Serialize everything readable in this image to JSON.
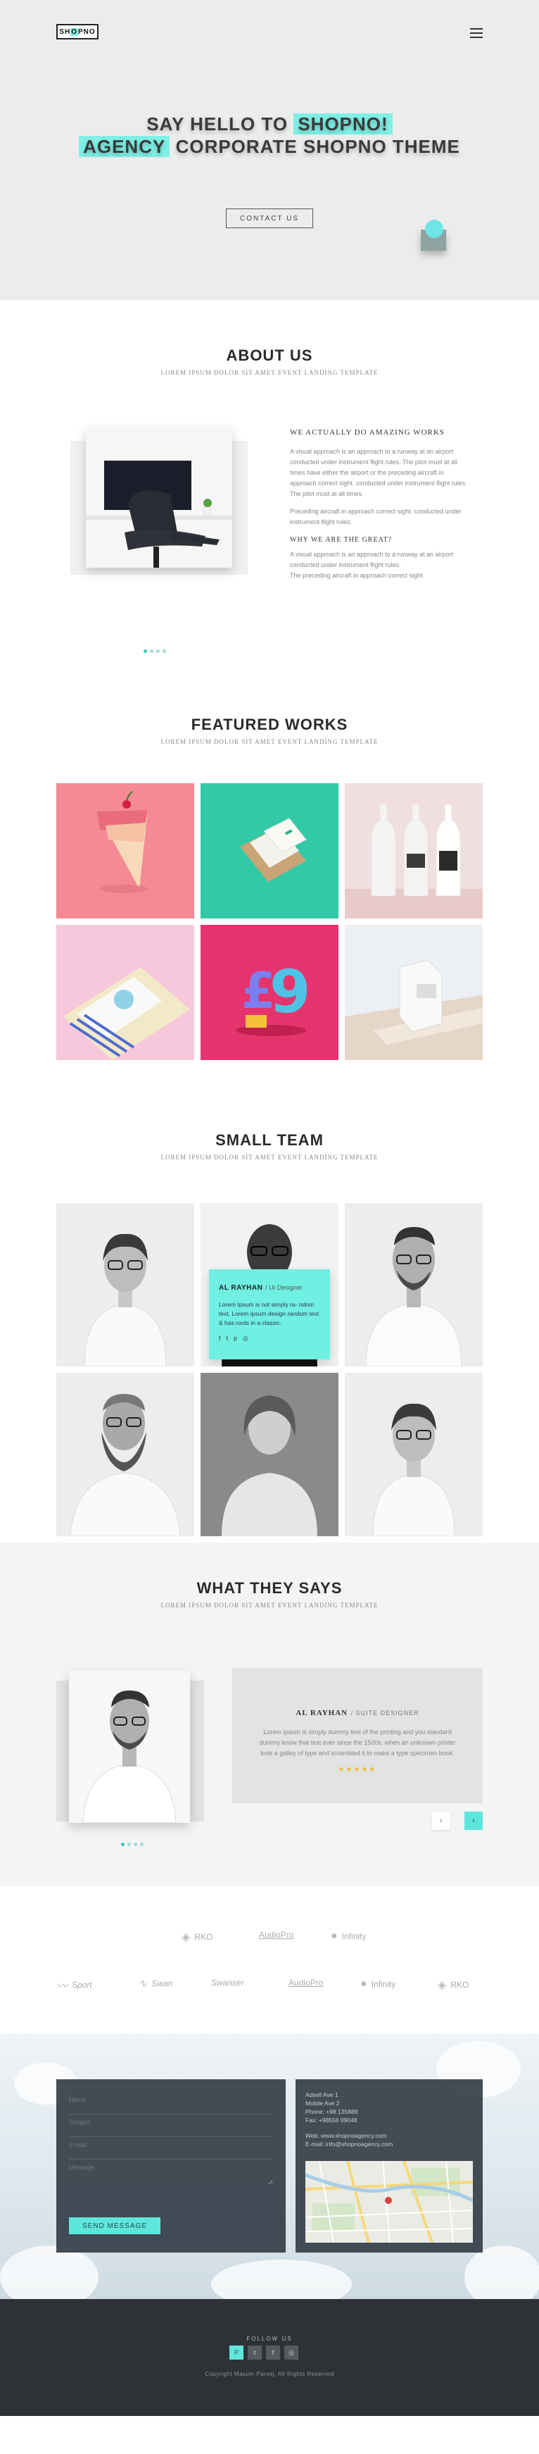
{
  "header": {
    "logo_left": "SH",
    "logo_highlight": "O",
    "logo_right": "PNO",
    "menu_icon": "hamburger-menu-icon"
  },
  "hero": {
    "line1_plain": "SAY HELLO TO ",
    "line1_highlight": "SHOPNO!",
    "line2_highlight": "AGENCY",
    "line2_plain": " CORPORATE SHOPNO THEME",
    "cta_label": "CONTACT US",
    "accent_color": "#7ff0e6"
  },
  "about": {
    "title": "ABOUT US",
    "subtitle": "LOREM IPSUM DOLOR SIT AMET EVENT LANDING TEMPLATE",
    "heading": "WE ACTUALLY DO AMAZING WORKS",
    "para1": "A visual approach is an approach to a runway at an airport conducted under instrument flight rules. The pilot must at all times have either the airport or the preceding aircraft in approach correct sight. conducted under instrument flight rules. The pilot must at all times.",
    "para2": "Preceding aircraft in approach correct sight. conducted under instrument flight rules.",
    "subheading": "WHY WE ARE THE GREAT?",
    "para3": "A visual approach is an approach to a runway at an airport conducted under instrument flight rules.",
    "para4": "The preceding aircraft in approach correct sight."
  },
  "featured": {
    "title": "FEATURED WORKS",
    "subtitle": "LOREM IPSUM DOLOR SIT AMET EVENT LANDING TEMPLATE"
  },
  "team": {
    "title": "SMALL TEAM",
    "subtitle": "LOREM IPSUM DOLOR SIT AMET EVENT LANDING TEMPLATE",
    "card_name": "AL RAYHAN",
    "card_role": "/ UI Designer",
    "card_text": "Lorem Ipsum is not simply ra- ndom text. Lorem ipsum design random text & has roots in a classic."
  },
  "testimonials": {
    "title": "WHAT THEY SAYS",
    "subtitle": "LOREM IPSUM DOLOR SIT AMET EVENT LANDING TEMPLATE",
    "name": "AL RAYHAN",
    "role": "/ SUITE DESIGNER",
    "quote": "Lorem Ipsum is simply dummy text of the printing and you standard dummy know that text ever since the 1500s, when an unknown printer took a galley of type and scrambled it to make a type specimen book.",
    "stars": "★★★★★",
    "prev": "‹",
    "next": "›"
  },
  "clients": {
    "row1": [
      "RKO",
      "AudioPro",
      "Infinity"
    ],
    "row2": [
      "Sport",
      "Swan",
      "Swanser",
      "AudioPro",
      "Infinity",
      "RKO"
    ]
  },
  "contact": {
    "name_placeholder": "Name",
    "subject_placeholder": "Subject",
    "email_placeholder": "E-mail",
    "message_placeholder": "Message",
    "send_label": "SEND MESSAGE",
    "address1": "Adsell Ave 1",
    "address2": "Mobile Ave 2",
    "phone": "Phone: +98 135889",
    "fax": "Fax: +98556 99048",
    "web": "Web: www.shopnoagency.com",
    "email": "E-mail: info@shopnoagency.com"
  },
  "footer": {
    "follow_label": "FOLLOW US",
    "social_icons": [
      "P",
      "t",
      "f",
      "◎"
    ],
    "copyright": "Copyright Masum Parvej, All Rights Reserved"
  }
}
